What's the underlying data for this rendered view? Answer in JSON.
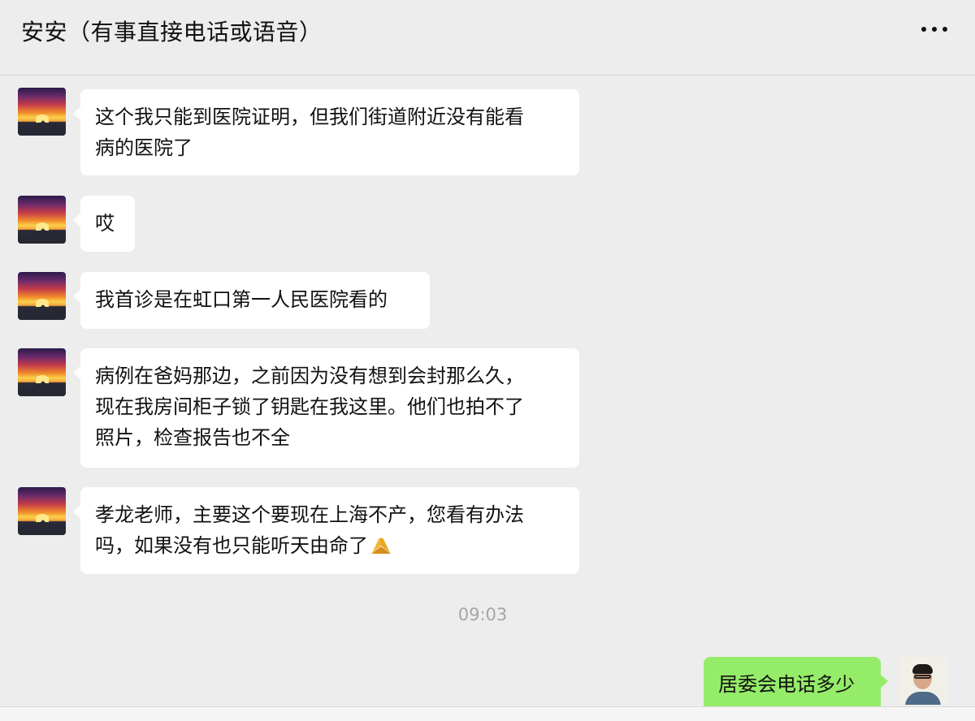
{
  "chat": {
    "title": "安安（有事直接电话或语音）"
  },
  "icons": {
    "more": "more-dots-icon",
    "avatar_in": "sunset-mountain-avatar",
    "avatar_out": "man-with-glasses-avatar",
    "prayer": "folded-hands-emoji"
  },
  "colors": {
    "background": "#ededed",
    "incoming_bubble": "#ffffff",
    "outgoing_bubble": "#95ec69",
    "timestamp": "#a6a6a6"
  },
  "messages": {
    "m1": {
      "line1": "这个我只能到医院证明，但我们街道附近没有能看",
      "line2": "病的医院了"
    },
    "m2": {
      "line1": "哎"
    },
    "m3": {
      "line1": "我首诊是在虹口第一人民医院看的"
    },
    "m4": {
      "line1": "病例在爸妈那边，之前因为没有想到会封那么久，",
      "line2": "现在我房间柜子锁了钥匙在我这里。他们也拍不了",
      "line3": "照片，检查报告也不全"
    },
    "m5": {
      "line1": "孝龙老师，主要这个要现在上海不产，您看有办法",
      "line2": "吗，如果没有也只能听天由命了"
    },
    "timestamp": "09:03",
    "m6": {
      "line1": "居委会电话多少"
    }
  }
}
